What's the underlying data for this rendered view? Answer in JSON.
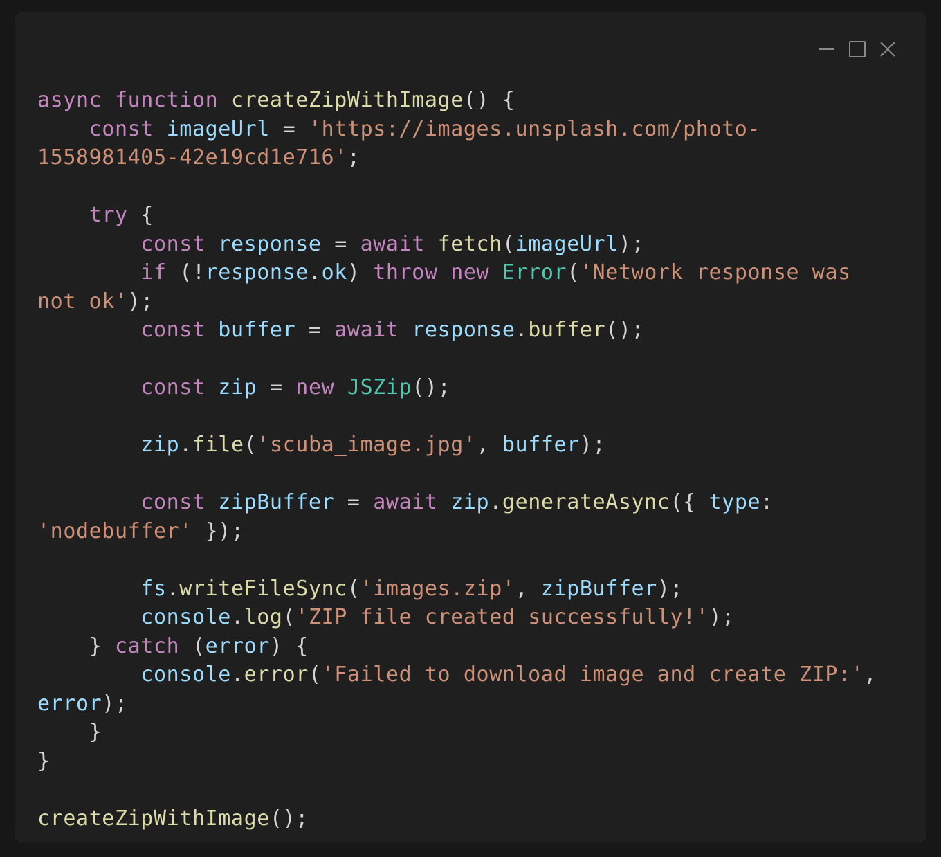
{
  "window": {
    "controls": {
      "minimize": "minimize-icon",
      "maximize": "maximize-icon",
      "close": "close-icon"
    }
  },
  "colors": {
    "background": "#1f1f1f",
    "keyword": "#c586c0",
    "function": "#dcdcaa",
    "variable": "#9cdcfe",
    "string": "#ce9178",
    "type": "#4ec9b0",
    "text": "#d4d4d4"
  },
  "code": {
    "lines": [
      [
        [
          "k",
          "async"
        ],
        [
          "p",
          " "
        ],
        [
          "k",
          "function"
        ],
        [
          "p",
          " "
        ],
        [
          "f",
          "createZipWithImage"
        ],
        [
          "p",
          "() {"
        ]
      ],
      [
        [
          "p",
          "    "
        ],
        [
          "k",
          "const"
        ],
        [
          "p",
          " "
        ],
        [
          "v",
          "imageUrl"
        ],
        [
          "p",
          " = "
        ],
        [
          "s",
          "'https://images.unsplash.com/photo-"
        ]
      ],
      [
        [
          "s",
          "1558981405-42e19cd1e716'"
        ],
        [
          "p",
          ";"
        ]
      ],
      [],
      [
        [
          "p",
          "    "
        ],
        [
          "k",
          "try"
        ],
        [
          "p",
          " {"
        ]
      ],
      [
        [
          "p",
          "        "
        ],
        [
          "k",
          "const"
        ],
        [
          "p",
          " "
        ],
        [
          "v",
          "response"
        ],
        [
          "p",
          " = "
        ],
        [
          "k",
          "await"
        ],
        [
          "p",
          " "
        ],
        [
          "f",
          "fetch"
        ],
        [
          "p",
          "("
        ],
        [
          "v",
          "imageUrl"
        ],
        [
          "p",
          ");"
        ]
      ],
      [
        [
          "p",
          "        "
        ],
        [
          "k",
          "if"
        ],
        [
          "p",
          " (!"
        ],
        [
          "v",
          "response"
        ],
        [
          "p",
          "."
        ],
        [
          "v",
          "ok"
        ],
        [
          "p",
          ") "
        ],
        [
          "k",
          "throw"
        ],
        [
          "p",
          " "
        ],
        [
          "k",
          "new"
        ],
        [
          "p",
          " "
        ],
        [
          "t",
          "Error"
        ],
        [
          "p",
          "("
        ],
        [
          "s",
          "'Network response was"
        ]
      ],
      [
        [
          "s",
          "not ok'"
        ],
        [
          "p",
          ");"
        ]
      ],
      [
        [
          "p",
          "        "
        ],
        [
          "k",
          "const"
        ],
        [
          "p",
          " "
        ],
        [
          "v",
          "buffer"
        ],
        [
          "p",
          " = "
        ],
        [
          "k",
          "await"
        ],
        [
          "p",
          " "
        ],
        [
          "v",
          "response"
        ],
        [
          "p",
          "."
        ],
        [
          "f",
          "buffer"
        ],
        [
          "p",
          "();"
        ]
      ],
      [],
      [
        [
          "p",
          "        "
        ],
        [
          "k",
          "const"
        ],
        [
          "p",
          " "
        ],
        [
          "v",
          "zip"
        ],
        [
          "p",
          " = "
        ],
        [
          "k",
          "new"
        ],
        [
          "p",
          " "
        ],
        [
          "t",
          "JSZip"
        ],
        [
          "p",
          "();"
        ]
      ],
      [],
      [
        [
          "p",
          "        "
        ],
        [
          "v",
          "zip"
        ],
        [
          "p",
          "."
        ],
        [
          "f",
          "file"
        ],
        [
          "p",
          "("
        ],
        [
          "s",
          "'scuba_image.jpg'"
        ],
        [
          "p",
          ", "
        ],
        [
          "v",
          "buffer"
        ],
        [
          "p",
          ");"
        ]
      ],
      [],
      [
        [
          "p",
          "        "
        ],
        [
          "k",
          "const"
        ],
        [
          "p",
          " "
        ],
        [
          "v",
          "zipBuffer"
        ],
        [
          "p",
          " = "
        ],
        [
          "k",
          "await"
        ],
        [
          "p",
          " "
        ],
        [
          "v",
          "zip"
        ],
        [
          "p",
          "."
        ],
        [
          "f",
          "generateAsync"
        ],
        [
          "p",
          "({ "
        ],
        [
          "v",
          "type"
        ],
        [
          "p",
          ":"
        ]
      ],
      [
        [
          "s",
          "'nodebuffer'"
        ],
        [
          "p",
          " });"
        ]
      ],
      [],
      [
        [
          "p",
          "        "
        ],
        [
          "v",
          "fs"
        ],
        [
          "p",
          "."
        ],
        [
          "f",
          "writeFileSync"
        ],
        [
          "p",
          "("
        ],
        [
          "s",
          "'images.zip'"
        ],
        [
          "p",
          ", "
        ],
        [
          "v",
          "zipBuffer"
        ],
        [
          "p",
          ");"
        ]
      ],
      [
        [
          "p",
          "        "
        ],
        [
          "v",
          "console"
        ],
        [
          "p",
          "."
        ],
        [
          "f",
          "log"
        ],
        [
          "p",
          "("
        ],
        [
          "s",
          "'ZIP file created successfully!'"
        ],
        [
          "p",
          ");"
        ]
      ],
      [
        [
          "p",
          "    } "
        ],
        [
          "k",
          "catch"
        ],
        [
          "p",
          " ("
        ],
        [
          "v",
          "error"
        ],
        [
          "p",
          ") {"
        ]
      ],
      [
        [
          "p",
          "        "
        ],
        [
          "v",
          "console"
        ],
        [
          "p",
          "."
        ],
        [
          "f",
          "error"
        ],
        [
          "p",
          "("
        ],
        [
          "s",
          "'Failed to download image and create ZIP:'"
        ],
        [
          "p",
          ","
        ]
      ],
      [
        [
          "v",
          "error"
        ],
        [
          "p",
          ");"
        ]
      ],
      [
        [
          "p",
          "    }"
        ]
      ],
      [
        [
          "p",
          "}"
        ]
      ],
      [],
      [
        [
          "f",
          "createZipWithImage"
        ],
        [
          "p",
          "();"
        ]
      ]
    ]
  }
}
